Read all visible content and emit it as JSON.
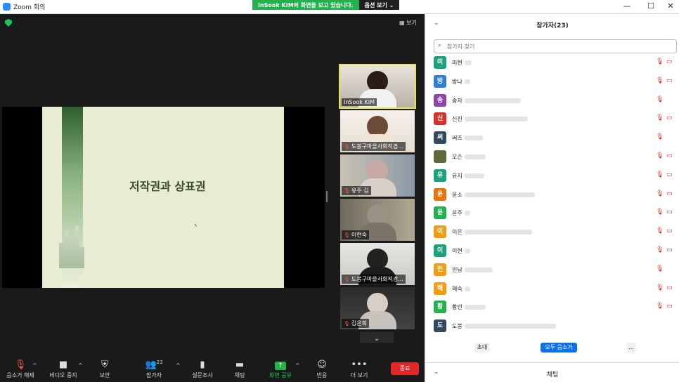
{
  "window": {
    "title": "Zoom 회의",
    "controls": [
      "—",
      "☐",
      "✕"
    ]
  },
  "share_banner": {
    "text": "InSook KIM의 화면을 보고 있습니다.",
    "options_label": "옵션 보기 ⌄"
  },
  "meeting": {
    "view_label": "보기",
    "slide_title": "저작권과 상표권",
    "thumbnails": [
      {
        "label": "InSook KIM",
        "muted": false
      },
      {
        "label": "도봉구마을사회적경...",
        "muted": true
      },
      {
        "label": "유주 김",
        "muted": true
      },
      {
        "label": "이현숙",
        "muted": true
      },
      {
        "label": "도봉구마을사회적경...",
        "muted": true
      },
      {
        "label": "김은희",
        "muted": true
      }
    ],
    "scroll_down": "⌄"
  },
  "toolbar": {
    "unmute": "음소거 해제",
    "stop_video": "비디오 중지",
    "security": "보안",
    "participants": "참가자",
    "participants_count": "23",
    "polls": "설문조사",
    "chat": "채팅",
    "share_screen": "화면 공유",
    "reactions": "반응",
    "more": "더 보기",
    "end": "종료"
  },
  "panel": {
    "title": "참가자(23)",
    "search_placeholder": "참가자 찾기",
    "participants": [
      {
        "initial": "미",
        "name": "미현",
        "color": "#1aa37a",
        "video": "off",
        "mic": "muted"
      },
      {
        "initial": "방",
        "name": "방나",
        "color": "#2d7ed8",
        "video": "off",
        "mic": "muted"
      },
      {
        "initial": "송",
        "name": "송자",
        "color": "#8e44ad",
        "video": "none",
        "mic": "muted"
      },
      {
        "initial": "신",
        "name": "신진",
        "color": "#d93025",
        "video": "off",
        "mic": "muted"
      },
      {
        "initial": "써",
        "name": "써즈",
        "color": "#34495e",
        "video": "none",
        "mic": "muted"
      },
      {
        "initial": "",
        "name": "오슨",
        "color": "#5b6b3a",
        "video": "off",
        "mic": "muted"
      },
      {
        "initial": "유",
        "name": "유지",
        "color": "#1aa37a",
        "video": "off",
        "mic": "muted"
      },
      {
        "initial": "윤",
        "name": "윤소",
        "color": "#e8710a",
        "video": "off",
        "mic": "muted"
      },
      {
        "initial": "윤",
        "name": "윤주",
        "color": "#22b14c",
        "video": "on",
        "mic": "muted"
      },
      {
        "initial": "이",
        "name": "이은",
        "color": "#f39c12",
        "video": "off",
        "mic": "muted"
      },
      {
        "initial": "이",
        "name": "이현",
        "color": "#1aa37a",
        "video": "on",
        "mic": "muted"
      },
      {
        "initial": "인",
        "name": "인남",
        "color": "#f39c12",
        "video": "none",
        "mic": "muted"
      },
      {
        "initial": "해",
        "name": "해숙",
        "color": "#f39c12",
        "video": "off",
        "mic": "muted"
      },
      {
        "initial": "황",
        "name": "황인",
        "color": "#22b14c",
        "video": "off",
        "mic": "muted"
      },
      {
        "initial": "도",
        "name": "도봉",
        "color": "#34495e",
        "video": "none",
        "mic": "none"
      }
    ],
    "invite": "초대",
    "mute_all": "모두 음소거",
    "more": "...",
    "chat_title": "채팅"
  }
}
